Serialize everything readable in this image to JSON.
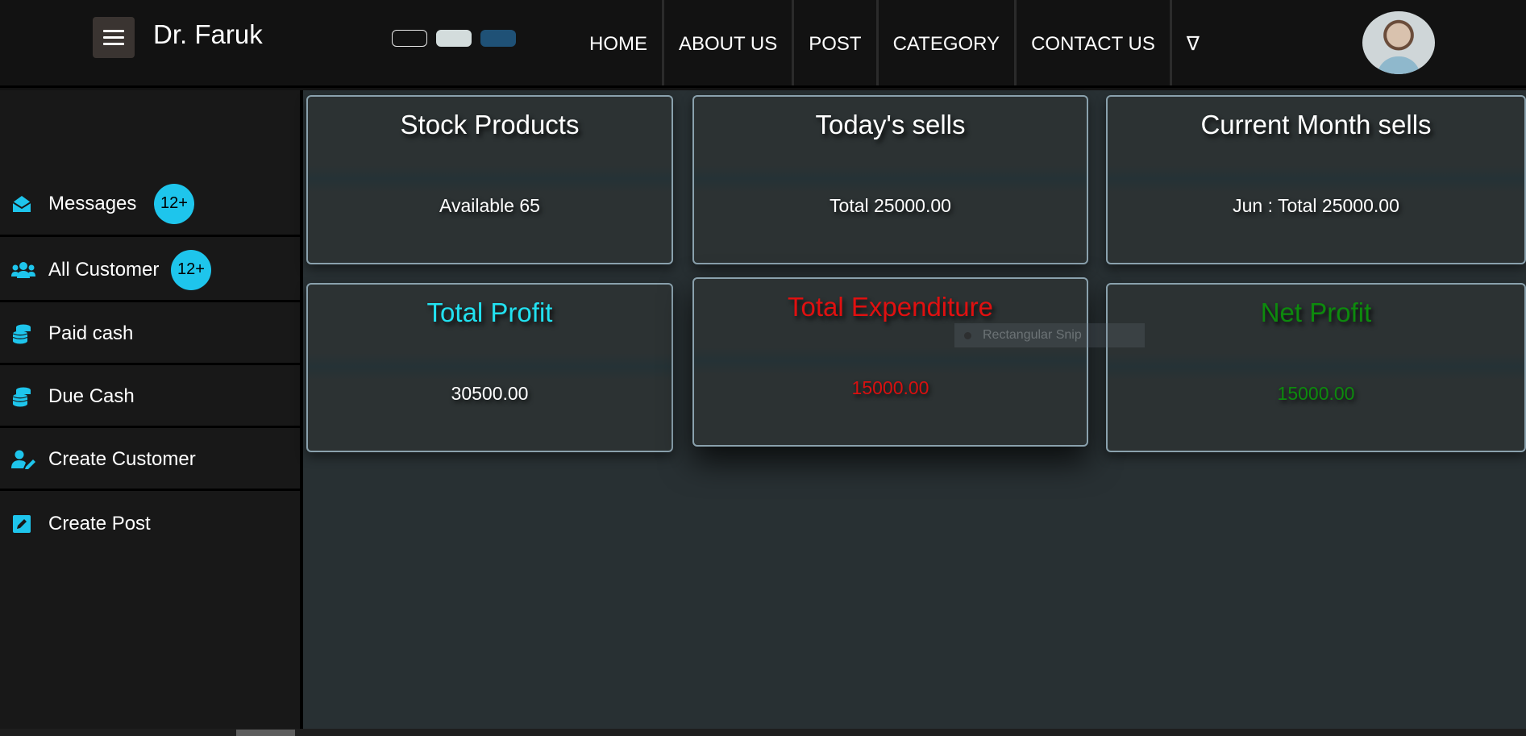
{
  "brand": {
    "name": "Dr. Faruk"
  },
  "theme_toggles": [
    {
      "name": "dark",
      "color": "#121212"
    },
    {
      "name": "light",
      "color": "#d3dcdc"
    },
    {
      "name": "blue",
      "color": "#1f5176"
    }
  ],
  "nav": {
    "items": [
      "HOME",
      "ABOUT US",
      "POST",
      "CATEGORY",
      "CONTACT US",
      "∇"
    ]
  },
  "sidebar": {
    "items": [
      {
        "label": "Messages",
        "icon": "envelope-open-icon",
        "badge": "12+"
      },
      {
        "label": "All Customer",
        "icon": "users-icon",
        "badge": "12+"
      },
      {
        "label": "Paid cash",
        "icon": "coins-icon"
      },
      {
        "label": "Due Cash",
        "icon": "coins-icon"
      },
      {
        "label": "Create Customer",
        "icon": "user-edit-icon"
      },
      {
        "label": "Create Post",
        "icon": "edit-square-icon"
      }
    ]
  },
  "cards": [
    {
      "title": "Stock Products",
      "value": "Available 65",
      "title_color": "#ffffff",
      "value_color": "#ffffff"
    },
    {
      "title": "Today's sells",
      "value": "Total 25000.00",
      "title_color": "#ffffff",
      "value_color": "#ffffff"
    },
    {
      "title": "Current Month sells",
      "value": "Jun : Total 25000.00",
      "title_color": "#ffffff",
      "value_color": "#ffffff"
    },
    {
      "title": "Total Profit",
      "value": "30500.00",
      "title_color": "#22e1f0",
      "value_color": "#ffffff"
    },
    {
      "title": "Total Expenditure",
      "value": "15000.00",
      "title_color": "#e01010",
      "value_color": "#d81010"
    },
    {
      "title": "Net Profit",
      "value": "15000.00",
      "title_color": "#0d8a0d",
      "value_color": "#0d8a0d"
    }
  ],
  "overlay": {
    "snip_label": "Rectangular Snip"
  },
  "colors": {
    "accent": "#1ec5ec",
    "background": "#121212",
    "main_background": "#283033"
  }
}
